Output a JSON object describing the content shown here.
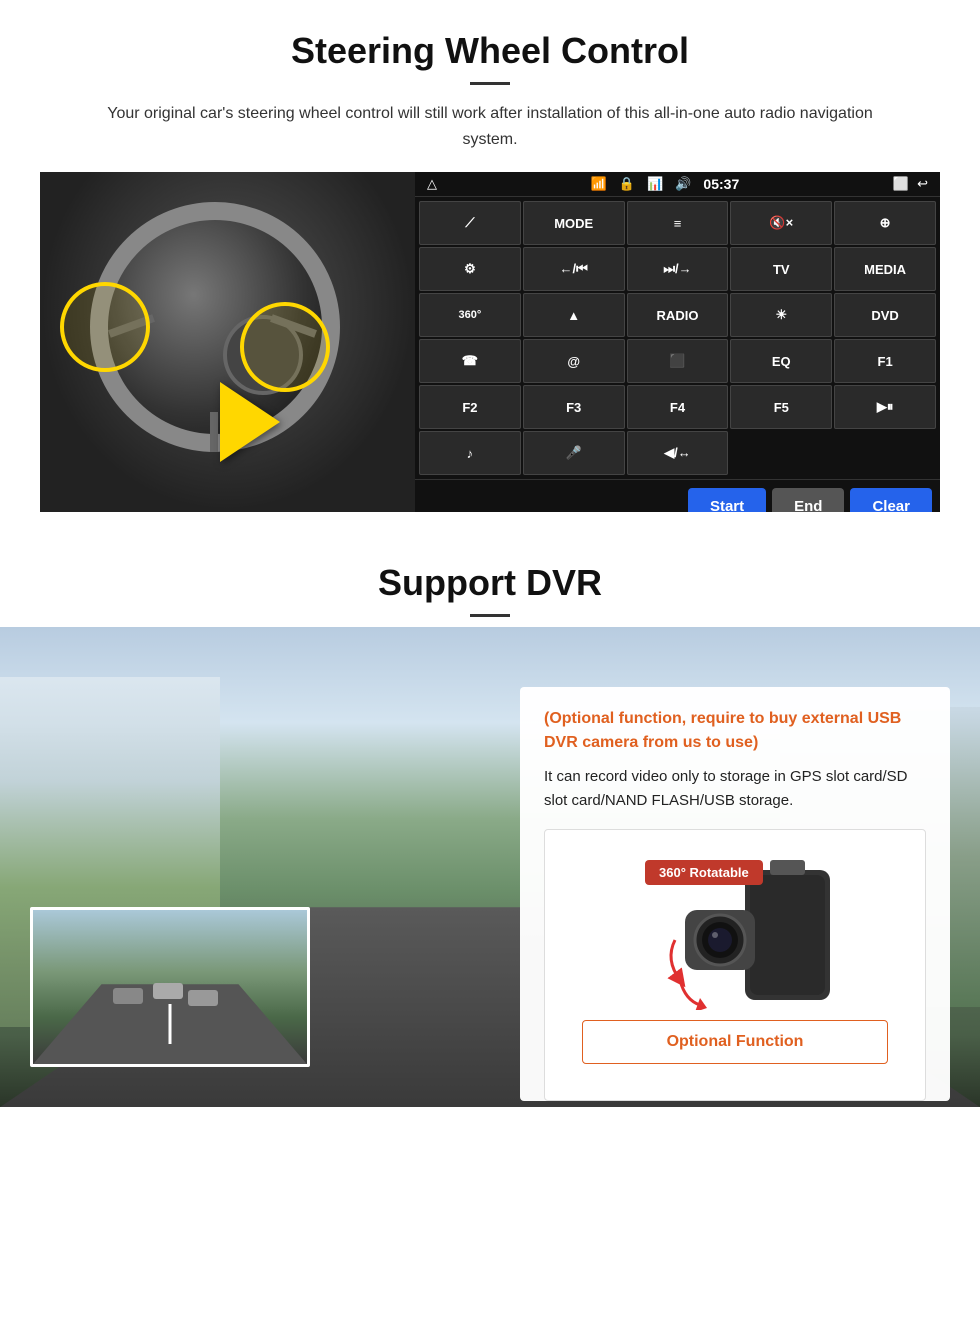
{
  "steering": {
    "title": "Steering Wheel Control",
    "description": "Your original car's steering wheel control will still work after installation of this all-in-one auto radio navigation system.",
    "status_bar": {
      "time": "05:37",
      "icons": [
        "wifi",
        "lock",
        "signal",
        "volume"
      ]
    },
    "ui_buttons": [
      {
        "label": "△",
        "icon": "home"
      },
      {
        "label": "",
        "icon": "nav-arrow"
      },
      {
        "label": "MODE"
      },
      {
        "label": "≡"
      },
      {
        "label": "🔇×"
      },
      {
        "label": "⊕"
      },
      {
        "label": "⚙",
        "icon": "settings"
      },
      {
        "label": "←/⏮"
      },
      {
        "label": "⏭/→"
      },
      {
        "label": "TV"
      },
      {
        "label": "MEDIA"
      },
      {
        "label": "360°",
        "icon": "camera"
      },
      {
        "label": "▲"
      },
      {
        "label": "RADIO"
      },
      {
        "label": "☀",
        "icon": "brightness"
      },
      {
        "label": "DVD"
      },
      {
        "label": "☎",
        "icon": "phone"
      },
      {
        "label": "@"
      },
      {
        "label": "⬛",
        "icon": "screen"
      },
      {
        "label": "EQ"
      },
      {
        "label": "F1"
      },
      {
        "label": "F2"
      },
      {
        "label": "F3"
      },
      {
        "label": "F4"
      },
      {
        "label": "F5"
      },
      {
        "label": "▶⏸"
      },
      {
        "label": "♪",
        "icon": "music"
      },
      {
        "label": "🎤",
        "icon": "mic"
      },
      {
        "label": "◀/↔",
        "icon": "prev"
      }
    ],
    "controls": {
      "start": "Start",
      "end": "End",
      "clear": "Clear"
    }
  },
  "dvr": {
    "title": "Support DVR",
    "optional_text": "(Optional function, require to buy external USB DVR camera from us to use)",
    "description": "It can record video only to storage in GPS slot card/SD slot card/NAND FLASH/USB storage.",
    "rotatable_badge": "360° Rotatable",
    "optional_function_btn": "Optional Function"
  }
}
